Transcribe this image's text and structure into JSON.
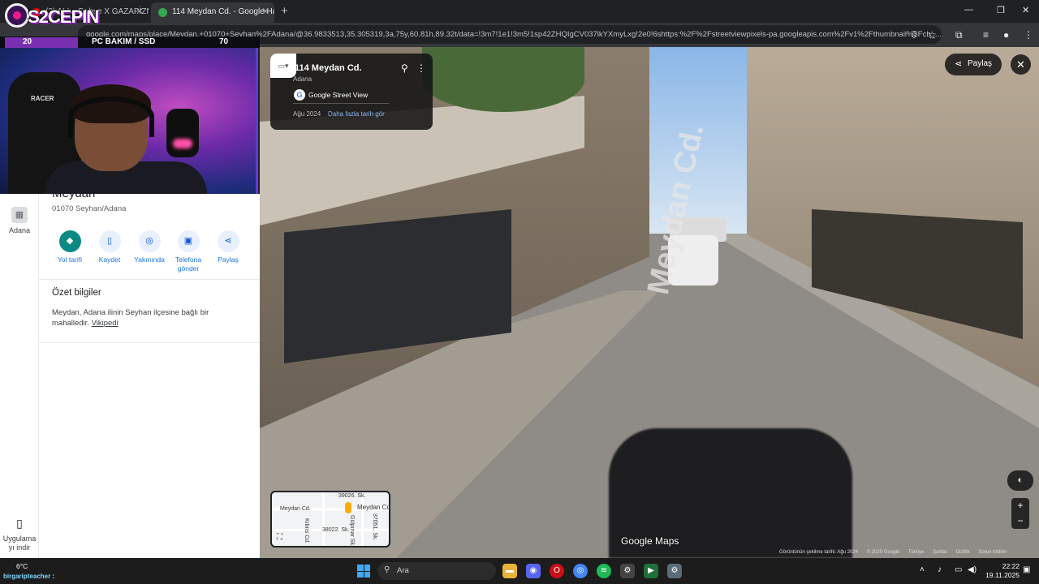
{
  "browser": {
    "tabs": [
      {
        "label": "(3) ALL...Dehşe X GAZAPİZM",
        "active": false
      },
      {
        "label": "114 Meydan Cd. - Google Haritalar",
        "active": true
      }
    ],
    "new_tab_label": "+",
    "url": "google.com/maps/place/Meydan,+01070+Seyhan%2FAdana/@36.9833513,35.305319,3a,75y,60.81h,89.32t/data=!3m7!1e1!3m5!1sp42ZHQIgCV037lkYXmyLxg!2e0!6shttps:%2F%2Fstreetviewpixels-pa.googleapis.com%2Fv1%2Fthumbnail%3Fcb_..."
  },
  "stream_overlay": {
    "brand": "S2CEPIN",
    "left_stat": "20",
    "label": "PC BAKIM / SSD",
    "right_stat": "70"
  },
  "rail": {
    "recent_label": "Adana",
    "app_label": "Uygulama yı indir"
  },
  "place": {
    "title": "Meydan",
    "address": "01070 Seyhan/Adana",
    "actions": [
      {
        "label": "Yol tarifi",
        "icon": "directions-icon"
      },
      {
        "label": "Kaydet",
        "icon": "bookmark-icon"
      },
      {
        "label": "Yakınında",
        "icon": "nearby-icon"
      },
      {
        "label": "Telefona gönder",
        "icon": "phone-icon"
      },
      {
        "label": "Paylaş",
        "icon": "share-icon"
      }
    ],
    "summary_heading": "Özet bilgiler",
    "summary_text": "Meydan, Adana ilinin Seyhan ilçesine bağlı bir mahalledir.",
    "summary_link": "Vikipedi"
  },
  "streetview": {
    "card_title": "114 Meydan Cd.",
    "card_subtitle": "Adana",
    "source": "Google Street View",
    "date": "Ağu 2024",
    "more_dates": "Daha fazla tarih gör",
    "share": "Paylaş",
    "road_marking": "Meydan Cd.",
    "watermark": "Google Maps",
    "footer": [
      "Görüntünün çekilme tarihi: Ağu 2024",
      "© 2025 Google",
      "Türkiye",
      "Şartlar",
      "Gizlilik",
      "Sorun bildirin"
    ]
  },
  "minimap": {
    "labels": [
      "39026. Sk.",
      "Meydan Cd.",
      "Meydan Cd.",
      "38022. Sk.",
      "Kıbrıs Cd.",
      "Gülpınar Sk.",
      "37051. Sk."
    ]
  },
  "taskbar": {
    "weather": "6°C",
    "chat_user": "birgaripteacher",
    "chat_msg": ":",
    "search_placeholder": "Ara",
    "time": "22:22",
    "date": "19.11.2025"
  }
}
